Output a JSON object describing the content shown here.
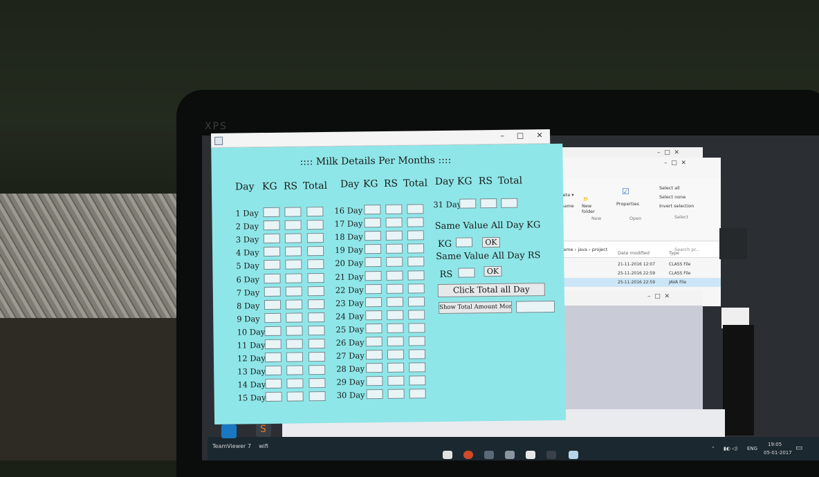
{
  "device": {
    "brand": "XPS"
  },
  "app": {
    "heading": ":::: Milk Details Per Months ::::",
    "window_buttons": {
      "minimize": "–",
      "maximize": "□",
      "close": "✕"
    },
    "columns": {
      "day": "Day",
      "kg": "KG",
      "rs": "RS",
      "total": "Total"
    },
    "col1_days": [
      "1 Day",
      "2 Day",
      "3 Day",
      "4 Day",
      "5 Day",
      "6 Day",
      "7 Day",
      "8 Day",
      "9 Day",
      "10 Day",
      "11 Day",
      "12 Day",
      "13 Day",
      "14 Day",
      "15 Day"
    ],
    "col2_days": [
      "16 Day",
      "17 Day",
      "18 Day",
      "19 Day",
      "20 Day",
      "21 Day",
      "22 Day",
      "23 Day",
      "24 Day",
      "25 Day",
      "26 Day",
      "27 Day",
      "28 Day",
      "29 Day",
      "30 Day"
    ],
    "col3_day": "31 Day",
    "same_kg_label": "Same Value All Day KG",
    "kg_label": "KG",
    "same_rs_label": "Same Value All Day RS",
    "rs_label": "RS",
    "ok_label": "OK",
    "total_all_day_button": "Click Total all Day",
    "show_total_button": "Show Total Amount Months"
  },
  "explorer": {
    "ribbon": {
      "delete": "Delete ▾",
      "rename": "Rename",
      "new_folder": "New folder",
      "new_group": "New",
      "properties": "Properties",
      "open_group": "Open",
      "select_all": "Select all",
      "select_none": "Select none",
      "invert_selection": "Invert selection",
      "select_group": "Select"
    },
    "path": "rograme › java › project",
    "search_placeholder": "Search pr...",
    "headers": {
      "date_modified": "Date modified",
      "type": "Type"
    },
    "files": [
      {
        "date": "21-11-2016 12:07",
        "type": "CLASS File"
      },
      {
        "date": "25-11-2016 22:59",
        "type": "CLASS File"
      },
      {
        "date": "25-11-2016 22:59",
        "type": "JAVA File"
      }
    ]
  },
  "taskbar": {
    "teamviewer_label": "TeamViewer 7",
    "wifi_label": "wifi",
    "language": "ENG",
    "time": "19:05",
    "date": "05-01-2017"
  }
}
